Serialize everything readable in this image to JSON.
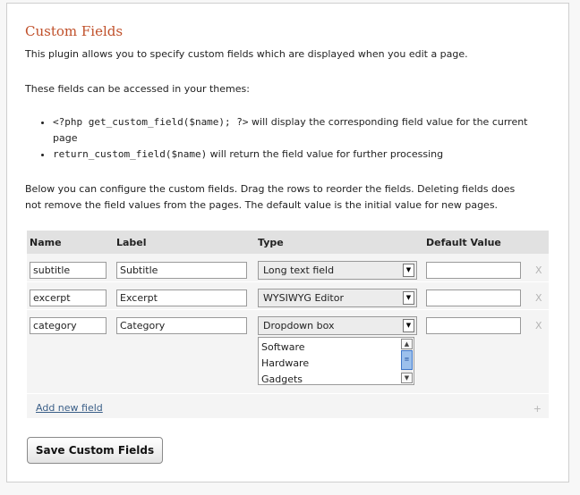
{
  "title": "Custom Fields",
  "intro": "This plugin allows you to specify custom fields which are displayed when you edit a page.",
  "access_text": "These fields can be accessed in your themes:",
  "bullets": [
    {
      "code": "<?php get_custom_field($name); ?>",
      "text": " will display the corresponding field value for the current page"
    },
    {
      "code": "return_custom_field($name)",
      "text": " will return the field value for further processing"
    }
  ],
  "configure_text": "Below you can configure the custom fields. Drag the rows to reorder the fields. Deleting fields does not remove the field values from the pages. The default value is the initial value for new pages.",
  "table": {
    "headers": {
      "name": "Name",
      "label": "Label",
      "type": "Type",
      "default": "Default Value"
    },
    "rows": [
      {
        "name": "subtitle",
        "label": "Subtitle",
        "type": "Long text field",
        "default": "",
        "delete": "X"
      },
      {
        "name": "excerpt",
        "label": "Excerpt",
        "type": "WYSIWYG Editor",
        "default": "",
        "delete": "X"
      },
      {
        "name": "category",
        "label": "Category",
        "type": "Dropdown box",
        "default": "",
        "delete": "X"
      }
    ],
    "dropdown_options": [
      "Software",
      "Hardware",
      "Gadgets"
    ],
    "add_link": "Add new field",
    "add_icon": "+"
  },
  "save_button": "Save Custom Fields",
  "colors": {
    "title": "#c0502a",
    "link": "#3b5f88",
    "header_bg": "#e1e1e1",
    "table_bg": "#f4f4f4"
  }
}
